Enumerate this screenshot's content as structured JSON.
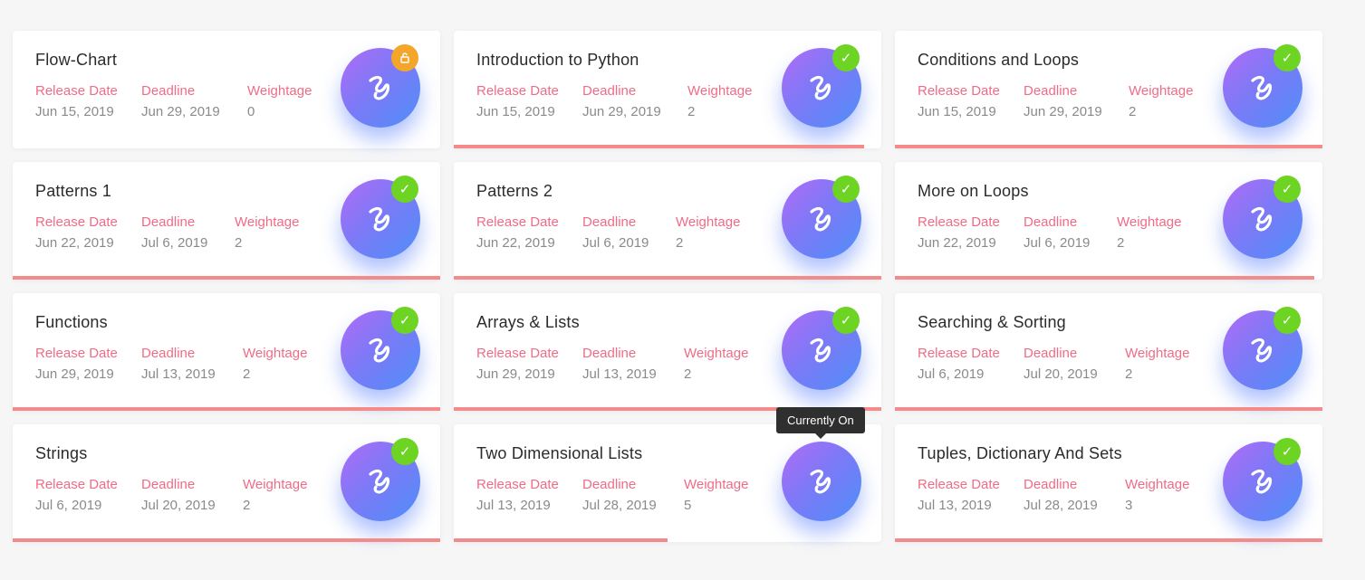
{
  "labels": {
    "release": "Release Date",
    "deadline": "Deadline",
    "weightage": "Weightage"
  },
  "tooltip": "Currently On",
  "colors": {
    "accent_label": "#f06c86",
    "progress": "#f48a8a",
    "done_badge": "#6ed424",
    "locked_badge": "#f4a62a"
  },
  "cards": [
    {
      "title": "Flow-Chart",
      "release": "Jun 15, 2019",
      "deadline": "Jun 29, 2019",
      "weightage": "0",
      "status": "locked",
      "status_icon": "lock-icon",
      "progress": 0,
      "deadline_col_width": 117
    },
    {
      "title": "Introduction to Python",
      "release": "Jun 15, 2019",
      "deadline": "Jun 29, 2019",
      "weightage": "2",
      "status": "done",
      "status_icon": "check-icon",
      "progress": 0.96,
      "deadline_col_width": 116
    },
    {
      "title": "Conditions and Loops",
      "release": "Jun 15, 2019",
      "deadline": "Jun 29, 2019",
      "weightage": "2",
      "status": "done",
      "status_icon": "check-icon",
      "progress": 1.0,
      "deadline_col_width": 116
    },
    {
      "title": "Patterns 1",
      "release": "Jun 22, 2019",
      "deadline": "Jul 6, 2019",
      "weightage": "2",
      "status": "done",
      "status_icon": "check-icon",
      "progress": 1.0,
      "deadline_col_width": 103
    },
    {
      "title": "Patterns 2",
      "release": "Jun 22, 2019",
      "deadline": "Jul 6, 2019",
      "weightage": "2",
      "status": "done",
      "status_icon": "check-icon",
      "progress": 1.0,
      "deadline_col_width": 103
    },
    {
      "title": "More on Loops",
      "release": "Jun 22, 2019",
      "deadline": "Jul 6, 2019",
      "weightage": "2",
      "status": "done",
      "status_icon": "check-icon",
      "progress": 0.98,
      "deadline_col_width": 103
    },
    {
      "title": "Functions",
      "release": "Jun 29, 2019",
      "deadline": "Jul 13, 2019",
      "weightage": "2",
      "status": "done",
      "status_icon": "check-icon",
      "progress": 1.0,
      "deadline_col_width": 112
    },
    {
      "title": "Arrays & Lists",
      "release": "Jun 29, 2019",
      "deadline": "Jul 13, 2019",
      "weightage": "2",
      "status": "done",
      "status_icon": "check-icon",
      "progress": 1.0,
      "deadline_col_width": 112
    },
    {
      "title": "Searching & Sorting",
      "release": "Jul 6, 2019",
      "deadline": "Jul 20, 2019",
      "weightage": "2",
      "status": "done",
      "status_icon": "check-icon",
      "progress": 1.0,
      "deadline_col_width": 112
    },
    {
      "title": "Strings",
      "release": "Jul 6, 2019",
      "deadline": "Jul 20, 2019",
      "weightage": "2",
      "status": "done",
      "status_icon": "check-icon",
      "progress": 1.0,
      "deadline_col_width": 112
    },
    {
      "title": "Two Dimensional Lists",
      "release": "Jul 13, 2019",
      "deadline": "Jul 28, 2019",
      "weightage": "5",
      "status": "current",
      "status_icon": "",
      "progress": 0.5,
      "deadline_col_width": 112
    },
    {
      "title": "Tuples, Dictionary And Sets",
      "release": "Jul 13, 2019",
      "deadline": "Jul 28, 2019",
      "weightage": "3",
      "status": "done",
      "status_icon": "check-icon",
      "progress": 1.0,
      "deadline_col_width": 112
    }
  ]
}
